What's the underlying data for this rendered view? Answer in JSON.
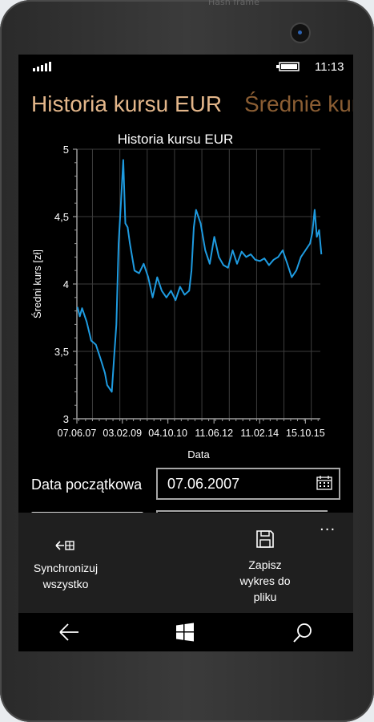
{
  "window_hint": "Hash frame",
  "status": {
    "time": "11:13"
  },
  "pivot": {
    "active": "Historia kursu EUR",
    "next": "Średnie kur"
  },
  "chart_data": {
    "type": "line",
    "title": "Historia kursu EUR",
    "xlabel": "Data",
    "ylabel": "Średni kurs [zł]",
    "ylim": [
      3,
      5
    ],
    "yticks": [
      "3",
      "3,5",
      "4",
      "4,5",
      "5"
    ],
    "xticks": [
      "07.06.07",
      "03.02.09",
      "04.10.10",
      "11.06.12",
      "11.02.14",
      "15.10.15"
    ],
    "xlim": [
      "2007-06-07",
      "2016-05-01"
    ],
    "grid": true,
    "line_color": "#1e9be0",
    "series": [
      {
        "x": [
          "2007-06",
          "2007-07",
          "2007-08",
          "2007-10",
          "2007-12",
          "2008-02",
          "2008-04",
          "2008-06",
          "2008-07",
          "2008-09",
          "2008-10",
          "2008-11",
          "2008-12",
          "2009-01",
          "2009-02",
          "2009-03",
          "2009-04",
          "2009-05",
          "2009-07",
          "2009-09",
          "2009-11",
          "2010-01",
          "2010-03",
          "2010-05",
          "2010-07",
          "2010-09",
          "2010-11",
          "2011-01",
          "2011-03",
          "2011-05",
          "2011-07",
          "2011-08",
          "2011-09",
          "2011-10",
          "2011-12",
          "2012-02",
          "2012-04",
          "2012-06",
          "2012-08",
          "2012-10",
          "2012-12",
          "2013-02",
          "2013-04",
          "2013-06",
          "2013-08",
          "2013-10",
          "2013-12",
          "2014-02",
          "2014-04",
          "2014-06",
          "2014-08",
          "2014-10",
          "2014-12",
          "2015-02",
          "2015-04",
          "2015-06",
          "2015-08",
          "2015-10",
          "2015-12",
          "2016-01",
          "2016-02",
          "2016-03",
          "2016-04",
          "2016-05"
        ],
        "y": [
          3.83,
          3.76,
          3.82,
          3.72,
          3.58,
          3.55,
          3.45,
          3.34,
          3.25,
          3.2,
          3.45,
          3.7,
          4.3,
          4.6,
          4.92,
          4.45,
          4.42,
          4.3,
          4.1,
          4.08,
          4.15,
          4.05,
          3.9,
          4.05,
          3.95,
          3.9,
          3.95,
          3.88,
          3.98,
          3.92,
          3.95,
          4.1,
          4.42,
          4.55,
          4.45,
          4.25,
          4.15,
          4.35,
          4.2,
          4.14,
          4.12,
          4.25,
          4.15,
          4.24,
          4.2,
          4.22,
          4.18,
          4.17,
          4.19,
          4.14,
          4.18,
          4.2,
          4.25,
          4.15,
          4.05,
          4.1,
          4.2,
          4.25,
          4.3,
          4.38,
          4.55,
          4.35,
          4.4,
          4.22
        ]
      }
    ]
  },
  "form": {
    "start_label": "Data początkowa",
    "start_value": "07.06.2007"
  },
  "appbar": {
    "sync_line1": "Synchronizuj",
    "sync_line2": "wszystko",
    "save_line1": "Zapisz",
    "save_line2": "wykres do",
    "save_line3": "pliku",
    "more": "..."
  }
}
